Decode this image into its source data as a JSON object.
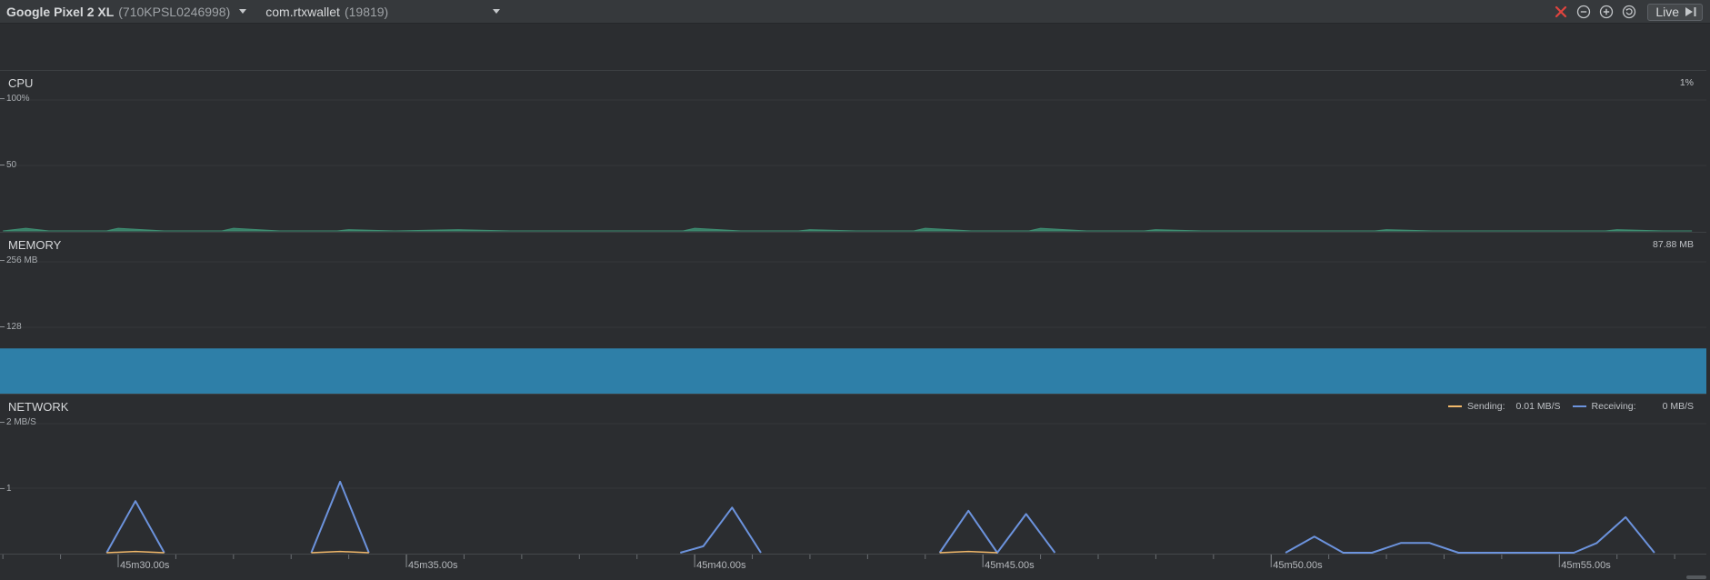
{
  "toolbar": {
    "device_name": "Google Pixel 2 XL",
    "device_serial": "(710KPSL0246998)",
    "process_name": "com.rtxwallet",
    "process_pid": "(19819)",
    "live_label": "Live",
    "icons": [
      "close-icon",
      "zoom-out-icon",
      "zoom-in-icon",
      "reset-zoom-icon",
      "play-to-end-icon"
    ],
    "colors": {
      "stop": "#e0443e"
    }
  },
  "cpu": {
    "title": "CPU",
    "current_value": "1%",
    "ticks": [
      "100%",
      "50"
    ],
    "color": "#3e8e72",
    "chart_data": {
      "type": "area",
      "x_unit": "s",
      "ylim": [
        0,
        100
      ],
      "x": [
        41,
        41.8,
        42.6,
        44.6,
        45,
        46.6,
        48.6,
        49,
        50.6,
        52.6,
        53,
        54.6,
        56.8,
        58.6,
        60.6,
        61,
        62.6,
        64.6,
        65,
        66.6,
        68.6,
        69,
        70.6,
        72.6,
        73,
        74.6,
        76.6,
        77,
        78.6,
        80.6,
        81,
        82.6,
        84.6,
        85,
        86.6,
        88.6,
        89,
        90.6,
        92.6,
        93,
        94.6,
        96.6,
        97,
        98.6,
        99.6
      ],
      "y": [
        0,
        2,
        0,
        0,
        2,
        0,
        0,
        2,
        0,
        0,
        1,
        0,
        1,
        0,
        0,
        0,
        0,
        0,
        2,
        0,
        0,
        1,
        0,
        0,
        2,
        0,
        0,
        2,
        0,
        0,
        1,
        0,
        0,
        0,
        0,
        0,
        1,
        0,
        0,
        0,
        0,
        0,
        1,
        0,
        0
      ]
    }
  },
  "memory": {
    "title": "MEMORY",
    "current_value": "87.88 MB",
    "ticks": [
      "256 MB",
      "128"
    ],
    "color": "#2e7fa8",
    "chart_data": {
      "type": "area",
      "x_unit": "s",
      "ylim": [
        0,
        256
      ],
      "x": [
        40.9,
        100.1
      ],
      "y": [
        87.88,
        87.88
      ]
    }
  },
  "network": {
    "title": "NETWORK",
    "legend": {
      "sending_label": "Sending:",
      "sending_value": "0.01 MB/S",
      "receiving_label": "Receiving:",
      "receiving_value": "0 MB/S"
    },
    "ticks": [
      "2 MB/S",
      "1"
    ],
    "colors": {
      "sending": "#f2b96b",
      "receiving": "#6c93dd"
    },
    "chart_data": {
      "type": "line",
      "x_unit": "s",
      "ylim": [
        0,
        2
      ],
      "series": [
        {
          "name": "Receiving",
          "x": [
            44.6,
            45.6,
            46.6,
            51.7,
            52.7,
            53.7,
            64.5,
            65.3,
            66.3,
            67.3,
            73.5,
            74.5,
            75.5,
            76.5,
            77.5,
            85.5,
            86.5,
            87.5,
            88.5,
            89.5,
            90.5,
            91.5,
            92.5,
            95.5,
            96.3,
            97.3,
            98.3
          ],
          "y": [
            0,
            0.8,
            0,
            0,
            1.1,
            0,
            0,
            0.1,
            0.7,
            0,
            0,
            0.65,
            0,
            0.6,
            0,
            0,
            0.25,
            0,
            0,
            0.15,
            0.15,
            0,
            0,
            0,
            0.15,
            0.55,
            0
          ]
        },
        {
          "name": "Sending",
          "x": [
            44.6,
            45.6,
            46.6,
            51.7,
            52.7,
            53.7,
            73.5,
            74.5,
            75.5
          ],
          "y": [
            0,
            0.02,
            0,
            0,
            0.02,
            0,
            0,
            0.02,
            0
          ]
        }
      ]
    }
  },
  "timeline": {
    "labels": [
      {
        "t": 45,
        "text": "45m30.00s"
      },
      {
        "t": 55,
        "text": "45m35.00s"
      },
      {
        "t": 65,
        "text": "45m40.00s"
      },
      {
        "t": 75,
        "text": "45m45.00s"
      },
      {
        "t": 85,
        "text": "45m50.00s"
      },
      {
        "t": 95,
        "text": "45m55.00s"
      }
    ],
    "minor_ticks": [
      41,
      43,
      47,
      49,
      51,
      53,
      57,
      59,
      61,
      63,
      67,
      69,
      71,
      73,
      77,
      79,
      81,
      83,
      87,
      89,
      91,
      93,
      97,
      99
    ]
  }
}
